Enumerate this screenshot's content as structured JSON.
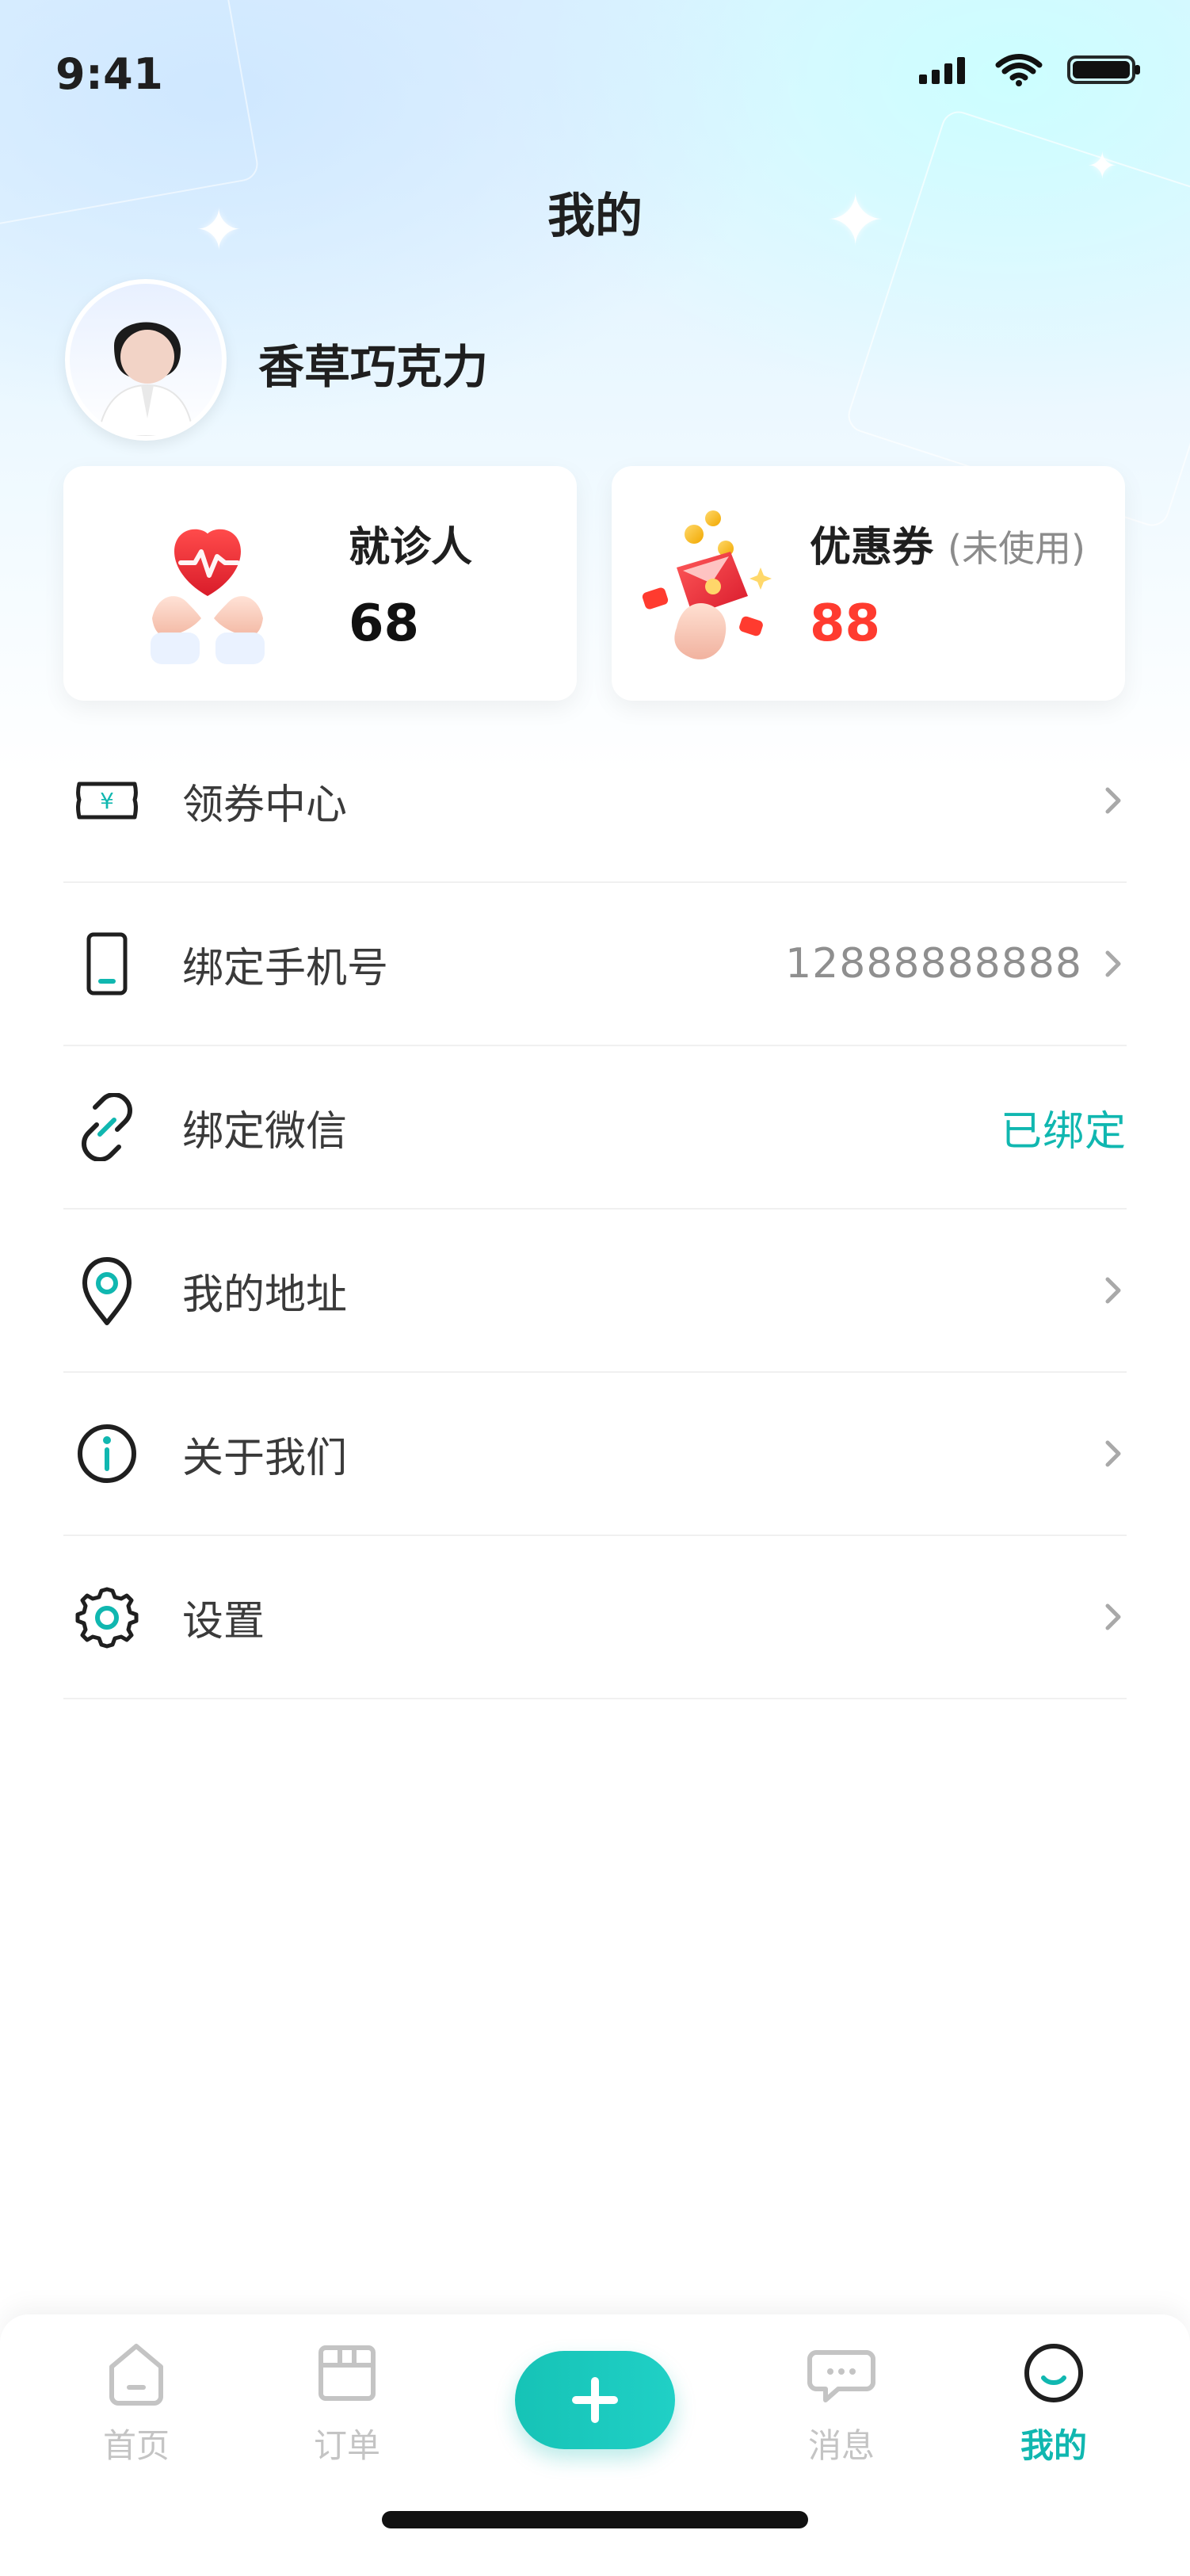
{
  "status_bar": {
    "time": "9:41"
  },
  "header": {
    "title": "我的"
  },
  "profile": {
    "name": "香草巧克力"
  },
  "cards": [
    {
      "label": "就诊人",
      "value": "68",
      "subtag": "",
      "value_color": "#111111"
    },
    {
      "label": "优惠券",
      "value": "88",
      "subtag": "(未使用)",
      "value_color": "#ff3b2f"
    }
  ],
  "menu": [
    {
      "label": "领券中心",
      "right_value": ""
    },
    {
      "label": "绑定手机号",
      "right_value": "12888888888"
    },
    {
      "label": "绑定微信",
      "right_value": "已绑定"
    },
    {
      "label": "我的地址",
      "right_value": ""
    },
    {
      "label": "关于我们",
      "right_value": ""
    },
    {
      "label": "设置",
      "right_value": ""
    }
  ],
  "tabbar": {
    "items": [
      {
        "label": "首页",
        "active": false
      },
      {
        "label": "订单",
        "active": false
      },
      {
        "label": "消息",
        "active": false
      },
      {
        "label": "我的",
        "active": true
      }
    ]
  },
  "colors": {
    "accent": "#10b7b0",
    "coupon": "#ff3b2f"
  }
}
